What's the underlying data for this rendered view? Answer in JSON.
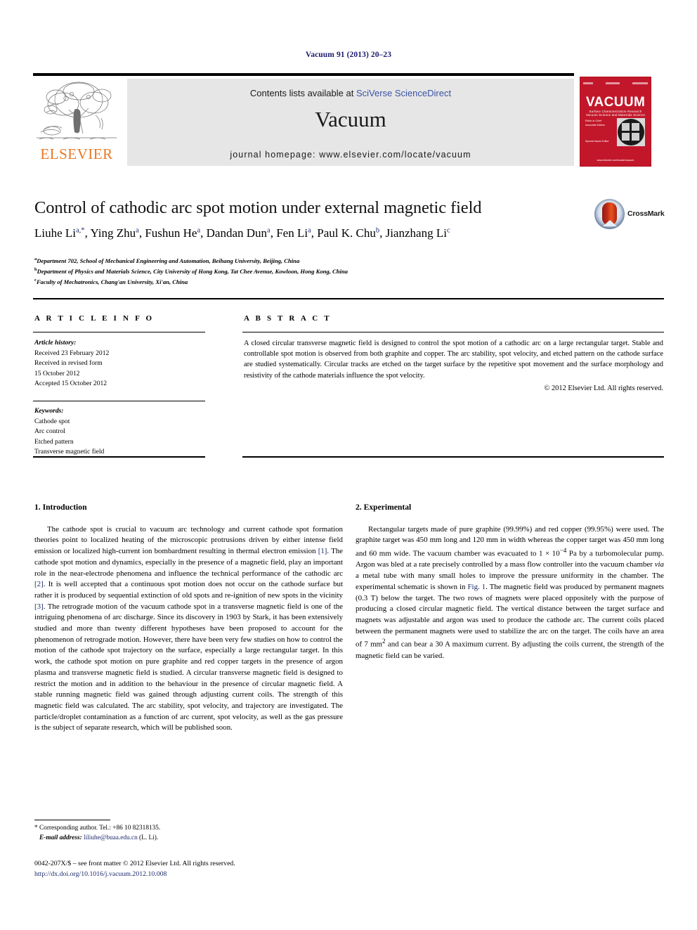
{
  "running_head": "Vacuum 91 (2013) 20–23",
  "header": {
    "contents_prefix": "Contents lists available at ",
    "contents_link": "SciVerse ScienceDirect",
    "journal_name": "Vacuum",
    "homepage": "journal homepage: www.elsevier.com/locate/vacuum",
    "publisher_logo_text": "ELSEVIER",
    "publisher_logo_icon": "elsevier-tree-icon",
    "cover": {
      "title": "VACUUM",
      "subtitle": "Surface Characterization Research Vacuum Science and Materials Science",
      "editors": "Editor-in-Chief:   Paul D. Mulvaney\nAssociate Editors:   Tuan Nhan B.\n                    John Anderson\n                    Hilary J. Michaelson\n                    Dana Alexandre\nSpecial Issues Editor:   Andre Anders",
      "footer": "www.elsevier.com/locate/vacuum"
    }
  },
  "title": "Control of cathodic arc spot motion under external magnetic field",
  "crossmark_label": "CrossMark",
  "authors": [
    {
      "name": "Liuhe Li",
      "marks": "a,*"
    },
    {
      "name": "Ying Zhu",
      "marks": "a"
    },
    {
      "name": "Fushun He",
      "marks": "a"
    },
    {
      "name": "Dandan Dun",
      "marks": "a"
    },
    {
      "name": "Fen Li",
      "marks": "a"
    },
    {
      "name": "Paul K. Chu",
      "marks": "b"
    },
    {
      "name": "Jianzhang Li",
      "marks": "c"
    }
  ],
  "affiliations": [
    {
      "mark": "a",
      "text": "Department 702, School of Mechanical Engineering and Automation, Beihang University, Beijing, China"
    },
    {
      "mark": "b",
      "text": "Department of Physics and Materials Science, City University of Hong Kong, Tat Chee Avenue, Kowloon, Hong Kong, China"
    },
    {
      "mark": "c",
      "text": "Faculty of Mechatronics, Chang'an University, Xi'an, China"
    }
  ],
  "article_info": {
    "heading": "A R T I C L E  I N F O",
    "history_label": "Article history:",
    "history_lines": [
      "Received 23 February 2012",
      "Received in revised form",
      "15 October 2012",
      "Accepted 15 October 2012"
    ],
    "keywords_label": "Keywords:",
    "keywords": [
      "Cathode spot",
      "Arc control",
      "Etched pattern",
      "Transverse magnetic field"
    ]
  },
  "abstract": {
    "heading": "A B S T R A C T",
    "text": "A closed circular transverse magnetic field is designed to control the spot motion of a cathodic arc on a large rectangular target. Stable and controllable spot motion is observed from both graphite and copper. The arc stability, spot velocity, and etched pattern on the cathode surface are studied systematically. Circular tracks are etched on the target surface by the repetitive spot movement and the surface morphology and resistivity of the cathode materials influence the spot velocity.",
    "copyright": "© 2012 Elsevier Ltd. All rights reserved."
  },
  "body": {
    "intro_heading": "1. Introduction",
    "intro_p1_a": "The cathode spot is crucial to vacuum arc technology and current cathode spot formation theories point to localized heating of the microscopic protrusions driven by either intense field emission or localized high-current ion bombardment resulting in thermal electron emission ",
    "ref1": "[1]",
    "intro_p1_b": ". The cathode spot motion and dynamics, especially in the presence of a magnetic field, play an important role in the near-electrode phenomena and influence the technical performance of the cathodic arc ",
    "ref2": "[2]",
    "intro_p1_c": ". It is well accepted that a continuous spot motion does not occur on the cathode surface but rather it is produced by sequential extinction of old spots and re-ignition of new spots in the vicinity ",
    "ref3": "[3]",
    "intro_p1_d": ". The retrograde motion of the vacuum cathode spot in a transverse magnetic field is one of the intriguing phenomena of arc discharge. Since its discovery in 1903 by Stark, it has been extensively studied and more than twenty different hypotheses have been proposed to account for the phenomenon of retrograde motion. However, there have been very few studies on how to control the motion of the cathode spot trajectory on the surface, especially a large rectangular target. In this work, the cathode spot motion on pure graphite and red copper targets in the presence of argon plasma and transverse magnetic field is studied. A circular transverse magnetic field is designed to restrict the motion and in addition to the behaviour in the presence of circular magnetic field. A stable running magnetic field was gained through adjusting current coils. The strength of this magnetic field was calculated. The arc stability, spot velocity, and trajectory are investigated. The particle/droplet contamination as a function of arc current, spot velocity, as well as the gas pressure is the subject of separate research, which will be published soon.",
    "experimental_heading": "2. Experimental",
    "exp_p1_a": "Rectangular targets made of pure graphite (99.99%) and red copper (99.95%) were used. The graphite target was 450 mm long and 120 mm in width whereas the copper target was 450 mm long and 60 mm wide. The vacuum chamber was evacuated to 1 × 10",
    "exp_sup1": "−4",
    "exp_p1_b": " Pa by a turbomolecular pump. Argon was bled at a rate precisely controlled by a mass flow controller into the vacuum chamber ",
    "exp_italic": "via",
    "exp_p1_c": " a metal tube with many small holes to improve the pressure uniformity in the chamber. The experimental schematic is shown in ",
    "exp_figref": "Fig. 1",
    "exp_p1_d": ". The magnetic field was produced by permanent magnets (0.3 T) below the target. The two rows of magnets were placed oppositely with the purpose of producing a closed circular magnetic field. The vertical distance between the target surface and magnets was adjustable and argon was used to produce the cathode arc. The current coils placed between the permanent magnets were used to stabilize the arc on the target. The coils have an area of 7 mm",
    "exp_sup2": "2",
    "exp_p1_e": " and can bear a 30 A maximum current. By adjusting the coils current, the strength of the magnetic field can be varied."
  },
  "footnote": {
    "corresponding": "* Corresponding author. Tel.: +86 10 82318135.",
    "email_label": "E-mail address:",
    "email": "liliuhe@buaa.edu.cn",
    "email_suffix": " (L. Li)."
  },
  "footer": {
    "issn_line": "0042-207X/$ – see front matter © 2012 Elsevier Ltd. All rights reserved.",
    "doi": "http://dx.doi.org/10.1016/j.vacuum.2012.10.008"
  },
  "colors": {
    "link": "#1b2a6b",
    "sciencedirect": "#3a53a4",
    "elsevier_orange": "#e87722",
    "cover_red": "#c2172a"
  }
}
